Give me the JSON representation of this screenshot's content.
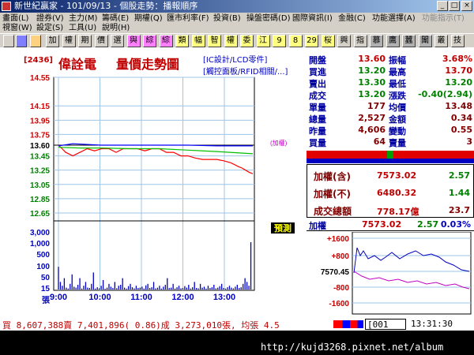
{
  "window": {
    "title": "新世紀贏家 - 101/09/13 - 個股走勢：播報順序",
    "buttons": [
      "_",
      "□",
      "×"
    ]
  },
  "menu": {
    "row1": [
      {
        "label": "畫面(L)"
      },
      {
        "label": "證券(V)"
      },
      {
        "label": "主力(M)"
      },
      {
        "label": "籌碼(E)"
      },
      {
        "label": "期權(Q)"
      },
      {
        "label": "匯市利率(F)"
      },
      {
        "label": "投資(B)"
      },
      {
        "label": "操盤密碼(D)"
      },
      {
        "label": "國際資訊(I)"
      },
      {
        "label": "金融(C)"
      },
      {
        "label": "功能選擇(A)"
      },
      {
        "label": "功能指示(T)",
        "disabled": true
      }
    ],
    "row2": [
      {
        "label": "視窗(W)"
      },
      {
        "label": "設定(S)"
      },
      {
        "label": "工具(U)"
      },
      {
        "label": "說明(H)"
      }
    ]
  },
  "toolbar": {
    "items": [
      "加",
      "權",
      "期",
      "價",
      "選",
      "與",
      "綜",
      "綜",
      "類",
      "幅",
      "智",
      "權",
      "委",
      "江",
      "9",
      "8",
      "29",
      "桜",
      "興",
      "指",
      "慕",
      "鷹",
      "蠶",
      "闈",
      "叢",
      "技"
    ],
    "colors": [
      "#d4d0c8",
      "#d4d0c8",
      "#d4d0c8",
      "#d4d0c8",
      "#d4d0c8",
      "#ff80ff",
      "#ff80ff",
      "#ff80ff",
      "#ffff80",
      "#ffff80",
      "#ffff80",
      "#ffff80",
      "#ffff80",
      "#ffff80",
      "#ffff80",
      "#ffff80",
      "#ffff80",
      "#ffff80",
      "#d4d0c8",
      "#d4d0c8",
      "#b0b0b0",
      "#b0b0b0",
      "#b0b0b0",
      "#b0b0b0",
      "#d4d0c8",
      "#d4d0c8"
    ]
  },
  "header": {
    "code": "[2436]",
    "name": "偉詮電",
    "subtitle": "量價走勢圖",
    "tag1": "[IC設計/LCD零件]",
    "tag2": "[觸控面板/RFID相關/...]",
    "index_label": "(加權)",
    "forecast_label": "預測"
  },
  "quote": {
    "rows": [
      {
        "l1": "開盤",
        "v1": "13.60",
        "l2": "振幅",
        "v2": "3.68%"
      },
      {
        "l1": "買進",
        "v1": "13.20",
        "l2": "最高",
        "v2": "13.70"
      },
      {
        "l1": "賣出",
        "v1": "13.30",
        "l2": "最低",
        "v2": "13.20"
      },
      {
        "l1": "成交",
        "v1": "13.20",
        "l2": "漲跌",
        "v2": "-0.40(2.94)"
      },
      {
        "l1": "單量",
        "v1": "177",
        "l2": "均價",
        "v2": "13.48"
      },
      {
        "l1": "總量",
        "v1": "2,527",
        "l2": "金額",
        "v2": "0.34"
      },
      {
        "l1": "昨量",
        "v1": "4,606",
        "l2": "變動",
        "v2": "0.55"
      },
      {
        "l1": "買量",
        "v1": "64",
        "l2": "賣量",
        "v2": "3"
      }
    ],
    "index_rows": [
      {
        "label": "加權(含)",
        "value": "7573.02",
        "change": "2.57"
      },
      {
        "label": "加權(不)",
        "value": "6480.32",
        "change": "1.44"
      },
      {
        "label": "成交總額",
        "value": "778.17億",
        "change": "23.7"
      }
    ],
    "mini": {
      "label": "加權",
      "value": "7573.02",
      "change": "2.57",
      "pct": "0.03%",
      "yticks": [
        "+1600",
        "+800",
        "7570.45",
        "-800",
        "-1600"
      ]
    }
  },
  "chart_data": {
    "type": "line",
    "price_ticks": [
      "14.55",
      "14.15",
      "13.95",
      "13.75",
      "13.60",
      "13.45",
      "13.25",
      "13.05",
      "12.85",
      "12.65"
    ],
    "volume_ticks": [
      "3,000",
      "1,000",
      "500",
      "100",
      "50",
      "15",
      "張"
    ],
    "x_ticks": [
      "9:00",
      "10:00",
      "11:00",
      "12:00",
      "13:00"
    ],
    "ylim": [
      12.65,
      14.55
    ],
    "reference": 13.6,
    "series": [
      {
        "name": "price",
        "color": "#ff0000",
        "x": [
          0,
          5,
          10,
          20,
          30,
          40,
          50,
          60,
          70,
          80,
          90,
          100,
          110,
          120,
          130,
          140,
          150,
          160,
          170,
          180,
          190,
          200,
          210,
          220,
          230,
          240,
          250,
          255,
          260,
          265,
          270
        ],
        "values": [
          13.6,
          13.55,
          13.5,
          13.45,
          13.5,
          13.55,
          13.52,
          13.55,
          13.55,
          13.5,
          13.55,
          13.55,
          13.55,
          13.52,
          13.55,
          13.55,
          13.5,
          13.5,
          13.45,
          13.45,
          13.42,
          13.4,
          13.4,
          13.4,
          13.38,
          13.35,
          13.3,
          13.28,
          13.25,
          13.22,
          13.2
        ]
      },
      {
        "name": "avg",
        "color": "#00c000",
        "x": [
          0,
          30,
          60,
          100,
          140,
          180,
          220,
          270
        ],
        "values": [
          13.57,
          13.56,
          13.56,
          13.55,
          13.55,
          13.53,
          13.51,
          13.48
        ]
      },
      {
        "name": "index",
        "color": "#0000ff",
        "x": [
          0,
          20,
          60,
          120,
          180,
          220,
          270
        ],
        "values": [
          13.59,
          13.62,
          13.6,
          13.6,
          13.6,
          13.59,
          13.59
        ]
      }
    ],
    "volumes": [
      120,
      40,
      20,
      60,
      10,
      5,
      30,
      80,
      15,
      10,
      25,
      60,
      5,
      20,
      40,
      10,
      8,
      30,
      90,
      5,
      12,
      6,
      20,
      50,
      4,
      10,
      30,
      15,
      8,
      40,
      7,
      20,
      25,
      60,
      10,
      5,
      18,
      30,
      12,
      6,
      20,
      8,
      10,
      15,
      5,
      22,
      30,
      8,
      12,
      40,
      6,
      10,
      20,
      5,
      15,
      25,
      60,
      8,
      10,
      30,
      5,
      12,
      20,
      6,
      8,
      18,
      10,
      25,
      5,
      12,
      40,
      8,
      6,
      30,
      10,
      15,
      5,
      20,
      8,
      12,
      25,
      6,
      10,
      18,
      30,
      8,
      5,
      12,
      20,
      10,
      6,
      15,
      25,
      8,
      12,
      30,
      60,
      40,
      20,
      250
    ]
  },
  "status": {
    "text": "買 8,607,388賣 7,401,896( 0.86)成 3,273,010張, 均張 4.5",
    "code": "[001",
    "time": "13:31:30"
  },
  "footer": {
    "url": "http://kujd3268.pixnet.net/album"
  }
}
